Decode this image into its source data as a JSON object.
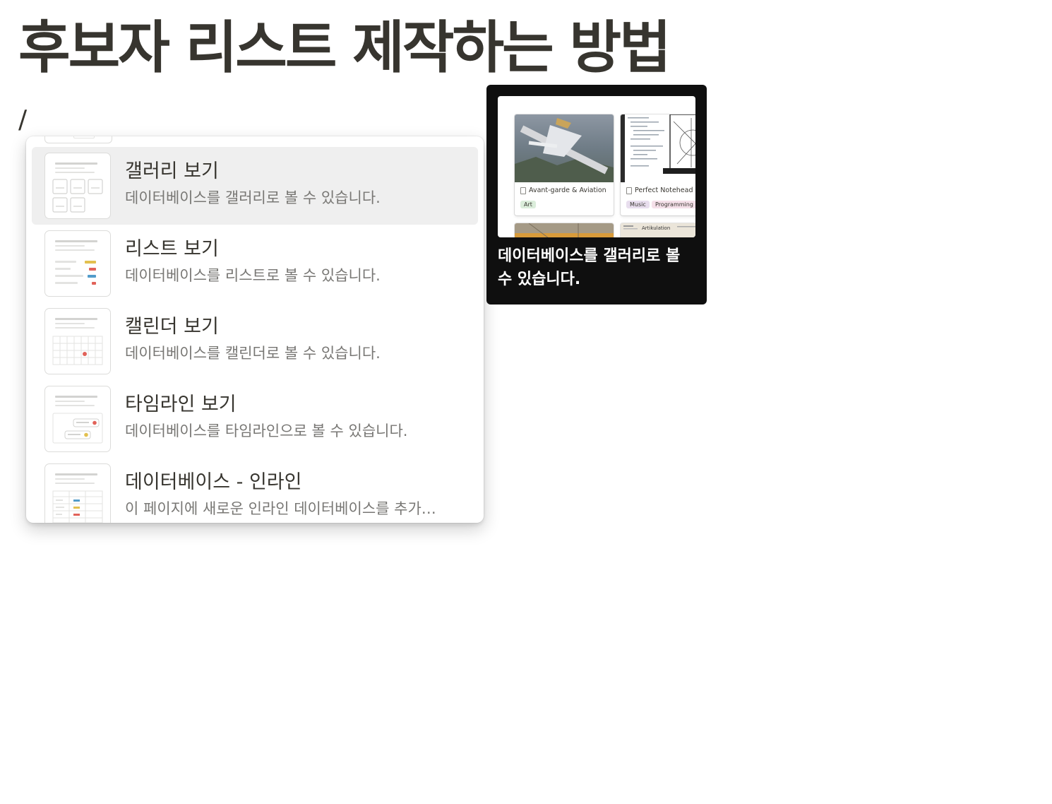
{
  "page": {
    "title": "후보자 리스트 제작하는 방법",
    "command_input": "/"
  },
  "menu": {
    "items": [
      {
        "title": "갤러리 보기",
        "description": "데이터베이스를 갤러리로 볼 수 있습니다.",
        "icon": "gallery-view-icon",
        "active": true
      },
      {
        "title": "리스트 보기",
        "description": "데이터베이스를 리스트로 볼 수 있습니다.",
        "icon": "list-view-icon",
        "active": false
      },
      {
        "title": "캘린더 보기",
        "description": "데이터베이스를 캘린더로 볼 수 있습니다.",
        "icon": "calendar-view-icon",
        "active": false
      },
      {
        "title": "타임라인 보기",
        "description": "데이터베이스를 타임라인으로 볼 수 있습니다.",
        "icon": "timeline-view-icon",
        "active": false
      },
      {
        "title": "데이터베이스 - 인라인",
        "description": "이 페이지에 새로운 인라인 데이터베이스를 추가…",
        "icon": "inline-database-icon",
        "active": false
      }
    ]
  },
  "preview": {
    "cards": [
      {
        "title": "Avant-garde & Aviation",
        "tags": [
          {
            "label": "Art",
            "color": "#dbeddb"
          }
        ]
      },
      {
        "title": "Perfect Notehead",
        "tags": [
          {
            "label": "Music",
            "color": "#e8deee"
          },
          {
            "label": "Programming",
            "color": "#f5e0e9"
          }
        ]
      }
    ],
    "bottom_card_text": "Artikulation",
    "description": "데이터베이스를 갤러리로 볼 수 있습니다."
  },
  "colors": {
    "text": "#37352f",
    "muted": "#787774",
    "hover": "#efefef",
    "tooltip_bg": "#0f0f0f",
    "red": "#e16259",
    "yellow": "#dfab01",
    "blue": "#529cca"
  }
}
